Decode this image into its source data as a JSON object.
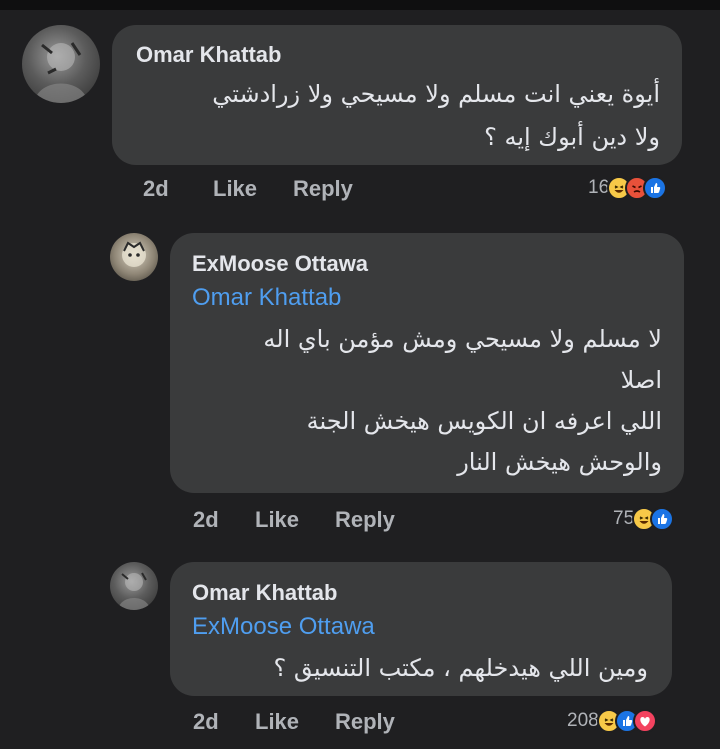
{
  "comments": [
    {
      "author": "Omar Khattab",
      "mention": "",
      "lines": [
        "أيوة يعني انت مسلم ولا مسيحي ولا زرادشتي",
        "ولا دين أبوك إيه ؟"
      ],
      "time": "2d",
      "like_label": "Like",
      "reply_label": "Reply",
      "reaction_count": "16",
      "reactions": [
        "haha-icon",
        "angry-icon",
        "like-icon"
      ]
    },
    {
      "author": "ExMoose Ottawa",
      "mention": "Omar Khattab",
      "lines": [
        "لا مسلم ولا مسيحي ومش مؤمن باي اله",
        "اصلا",
        "اللي اعرفه ان الكويس هيخش الجنة",
        "والوحش هيخش النار"
      ],
      "time": "2d",
      "like_label": "Like",
      "reply_label": "Reply",
      "reaction_count": "75",
      "reactions": [
        "haha-icon",
        "like-icon"
      ]
    },
    {
      "author": "Omar Khattab",
      "mention": "ExMoose Ottawa",
      "lines": [
        "ومين اللي هيدخلهم ، مكتب التنسيق ؟"
      ],
      "time": "2d",
      "like_label": "Like",
      "reply_label": "Reply",
      "reaction_count": "208",
      "reactions": [
        "haha-icon",
        "like-icon",
        "love-icon"
      ]
    }
  ],
  "colors": {
    "background": "#1f1f21",
    "bubble": "#3a3b3c",
    "mention": "#4f9ef0",
    "meta_text": "#b0b3b8",
    "primary_text": "#e4e6eb"
  }
}
